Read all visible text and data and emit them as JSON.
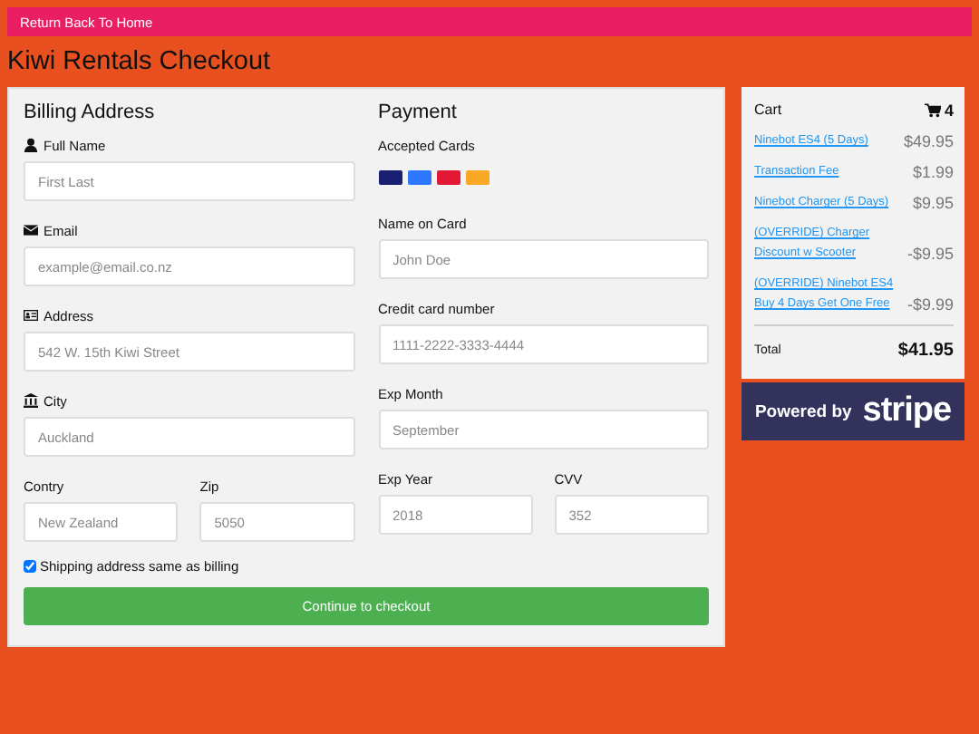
{
  "top_bar": {
    "link": "Return Back To Home"
  },
  "title": "Kiwi Rentals Checkout",
  "billing": {
    "heading": "Billing Address",
    "fields": [
      {
        "label": "Full Name",
        "placeholder": "First Last"
      },
      {
        "label": "Email",
        "placeholder": "example@email.co.nz"
      },
      {
        "label": "Address",
        "placeholder": "542 W. 15th Kiwi Street"
      },
      {
        "label": "City",
        "placeholder": "Auckland"
      }
    ],
    "pair": [
      {
        "label": "Contry",
        "placeholder": "New Zealand"
      },
      {
        "label": "Zip",
        "placeholder": "5050"
      }
    ]
  },
  "payment": {
    "heading": "Payment",
    "accepted_label": "Accepted Cards",
    "cards": [
      {
        "color": "#1a1f71"
      },
      {
        "color": "#2e77ff"
      },
      {
        "color": "#e21836"
      },
      {
        "color": "#f9a825"
      }
    ],
    "fields": [
      {
        "label": "Name on Card",
        "placeholder": "John Doe"
      },
      {
        "label": "Credit card number",
        "placeholder": "1111-2222-3333-4444"
      },
      {
        "label": "Exp Month",
        "placeholder": "September"
      }
    ],
    "pair": [
      {
        "label": "Exp Year",
        "placeholder": "2018"
      },
      {
        "label": "CVV",
        "placeholder": "352"
      }
    ]
  },
  "shipping_same": {
    "label": "Shipping address same as billing",
    "checked": true
  },
  "submit": "Continue to checkout",
  "cart": {
    "title": "Cart",
    "count": "4",
    "items": [
      {
        "name": "Ninebot ES4 (5 Days)",
        "price": "$49.95"
      },
      {
        "name": "Transaction Fee",
        "price": "$1.99"
      },
      {
        "name": "Ninebot Charger (5 Days)",
        "price": "$9.95"
      },
      {
        "name": "(OVERRIDE) Charger Discount w Scooter",
        "price": "-$9.95"
      },
      {
        "name": "(OVERRIDE) Ninebot ES4 Buy 4 Days Get One Free",
        "price": "-$9.99"
      }
    ],
    "total_label": "Total",
    "total": "$41.95"
  },
  "stripe": {
    "prefix": "Powered by",
    "brand": "stripe"
  }
}
